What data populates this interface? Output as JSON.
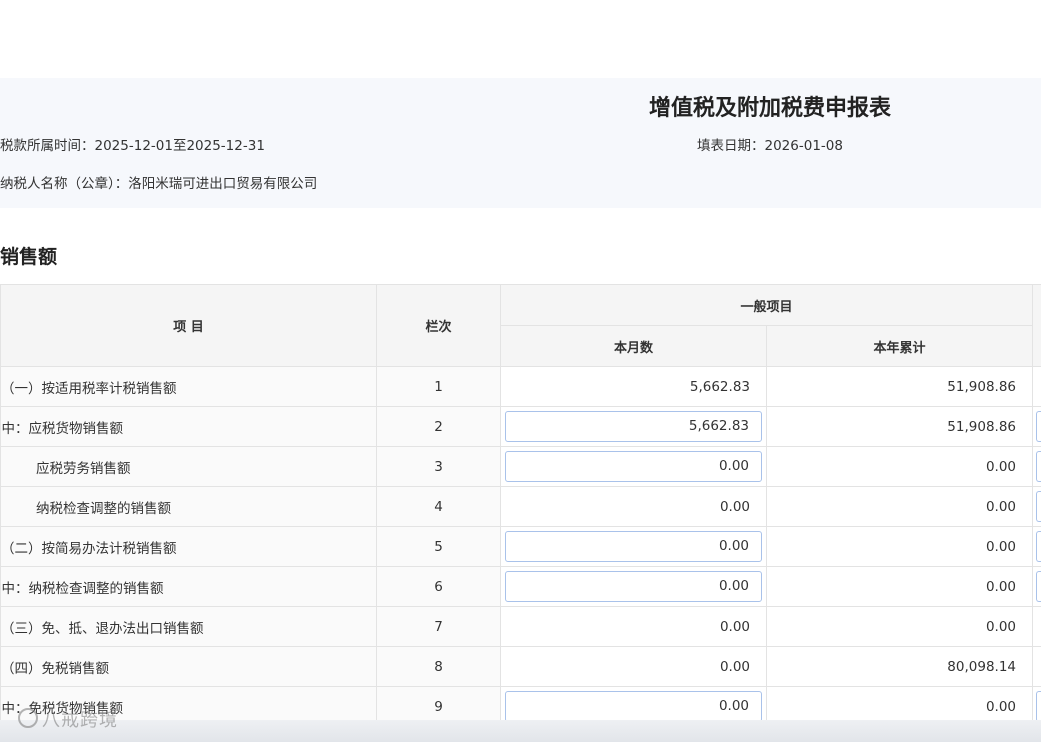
{
  "header": {
    "title": "增值税及附加税费申报表",
    "tax_period": "税款所属时间：2025-12-01至2025-12-31",
    "fill_date": "填表日期：2026-01-08",
    "taxpayer": "纳税人名称（公章）：洛阳米瑞可进出口贸易有限公司"
  },
  "section": {
    "title": "销售额"
  },
  "table": {
    "headers": {
      "item": "项 目",
      "column_no": "栏次",
      "general": "一般项目",
      "this_month": "本月数",
      "year_total": "本年累计"
    },
    "rows": [
      {
        "item": "（一）按适用税率计税销售额",
        "no": "1",
        "month": "5,662.83",
        "year": "51,908.86"
      },
      {
        "item": "其中：应税货物销售额",
        "no": "2",
        "month": "5,662.83",
        "year": "51,908.86"
      },
      {
        "item": "应税劳务销售额",
        "no": "3",
        "month": "0.00",
        "year": "0.00"
      },
      {
        "item": "纳税检查调整的销售额",
        "no": "4",
        "month": "0.00",
        "year": "0.00"
      },
      {
        "item": "（二）按简易办法计税销售额",
        "no": "5",
        "month": "0.00",
        "year": "0.00"
      },
      {
        "item": "其中：纳税检查调整的销售额",
        "no": "6",
        "month": "0.00",
        "year": "0.00"
      },
      {
        "item": "（三）免、抵、退办法出口销售额",
        "no": "7",
        "month": "0.00",
        "year": "0.00"
      },
      {
        "item": "（四）免税销售额",
        "no": "8",
        "month": "0.00",
        "year": "80,098.14"
      },
      {
        "item": "其中：免税货物销售额",
        "no": "9",
        "month": "0.00",
        "year": "0.00"
      }
    ]
  },
  "watermark": {
    "text": "八戒跨境"
  }
}
